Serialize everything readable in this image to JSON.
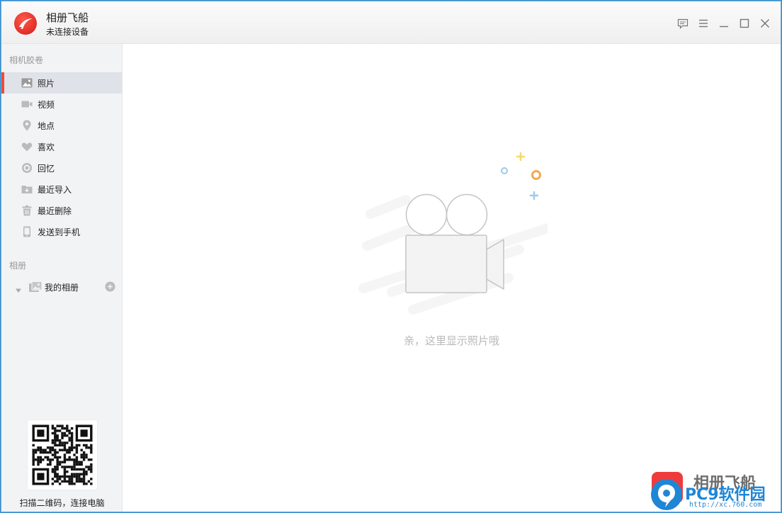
{
  "app": {
    "title": "相册飞船",
    "status": "未连接设备"
  },
  "window_controls": [
    {
      "name": "feedback-icon"
    },
    {
      "name": "menu-icon"
    },
    {
      "name": "minimize-icon"
    },
    {
      "name": "maximize-icon"
    },
    {
      "name": "close-icon"
    }
  ],
  "sidebar": {
    "roll_title": "相机胶卷",
    "items": [
      {
        "label": "照片",
        "icon": "photo-icon",
        "active": true
      },
      {
        "label": "视频",
        "icon": "video-icon"
      },
      {
        "label": "地点",
        "icon": "location-pin-icon"
      },
      {
        "label": "喜欢",
        "icon": "heart-icon"
      },
      {
        "label": "回忆",
        "icon": "memory-icon"
      },
      {
        "label": "最近导入",
        "icon": "import-folder-icon"
      },
      {
        "label": "最近删除",
        "icon": "trash-icon"
      },
      {
        "label": "发送到手机",
        "icon": "phone-icon"
      }
    ],
    "albums_title": "相册",
    "my_albums_label": "我的相册",
    "qr_caption": "扫描二维码，连接电脑"
  },
  "main": {
    "empty_text": "亲，这里显示照片哦"
  },
  "watermark": {
    "brand": "PC9软件园",
    "url": "http://xc.760.com",
    "overlay_text": "相册飞船"
  },
  "colors": {
    "accent": "#f04a3a",
    "sidebar_bg": "#f2f3f5",
    "active_bg": "#dfe2e8",
    "empty_text": "#b9b9b9",
    "watermark_blue": "#1f86d6"
  }
}
